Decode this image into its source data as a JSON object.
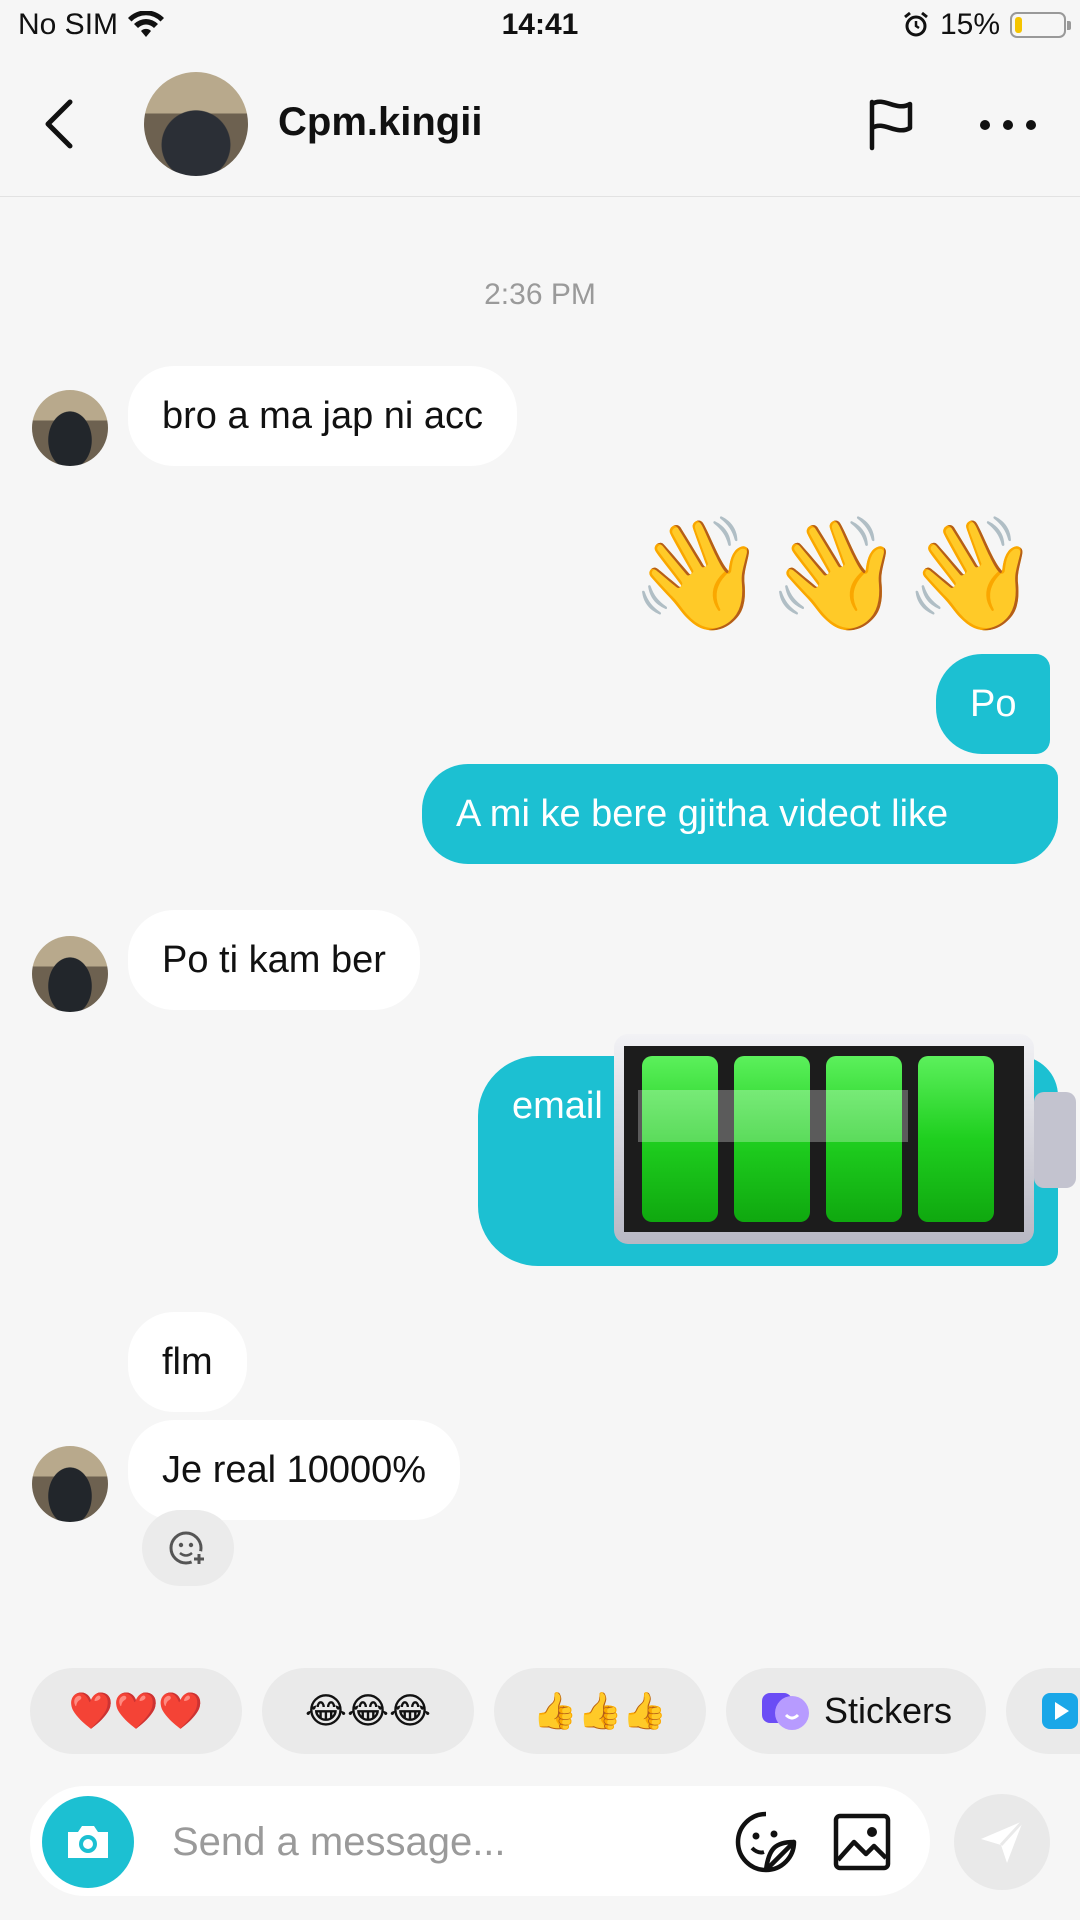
{
  "status_bar": {
    "carrier": "No SIM",
    "time": "14:41",
    "battery_percent_label": "15%",
    "battery_level": 0.15
  },
  "header": {
    "contact_name": "Cpm.kingii"
  },
  "chat": {
    "timestamp": "2:36 PM",
    "messages": [
      {
        "from": "them",
        "text": "bro a ma jap ni acc"
      },
      {
        "from": "me",
        "text": "👋👋👋"
      },
      {
        "from": "me",
        "text": "Po"
      },
      {
        "from": "me",
        "text": "A mi ke bere gjitha videot like"
      },
      {
        "from": "them",
        "text": "Po ti kam ber"
      },
      {
        "from": "me",
        "text": "email"
      },
      {
        "from": "them",
        "text": "flm"
      },
      {
        "from": "them",
        "text": "Je real 10000%"
      }
    ]
  },
  "quick_replies": [
    {
      "label": "❤️❤️❤️"
    },
    {
      "label": "😂😂😂"
    },
    {
      "label": "👍👍👍"
    },
    {
      "label": "Stickers",
      "icon": "stickers-icon"
    },
    {
      "label": "",
      "icon": "play-icon"
    }
  ],
  "composer": {
    "placeholder": "Send a message..."
  },
  "colors": {
    "accent": "#1cc0d2",
    "bubble_in": "#ffffff",
    "background": "#f6f6f6"
  }
}
